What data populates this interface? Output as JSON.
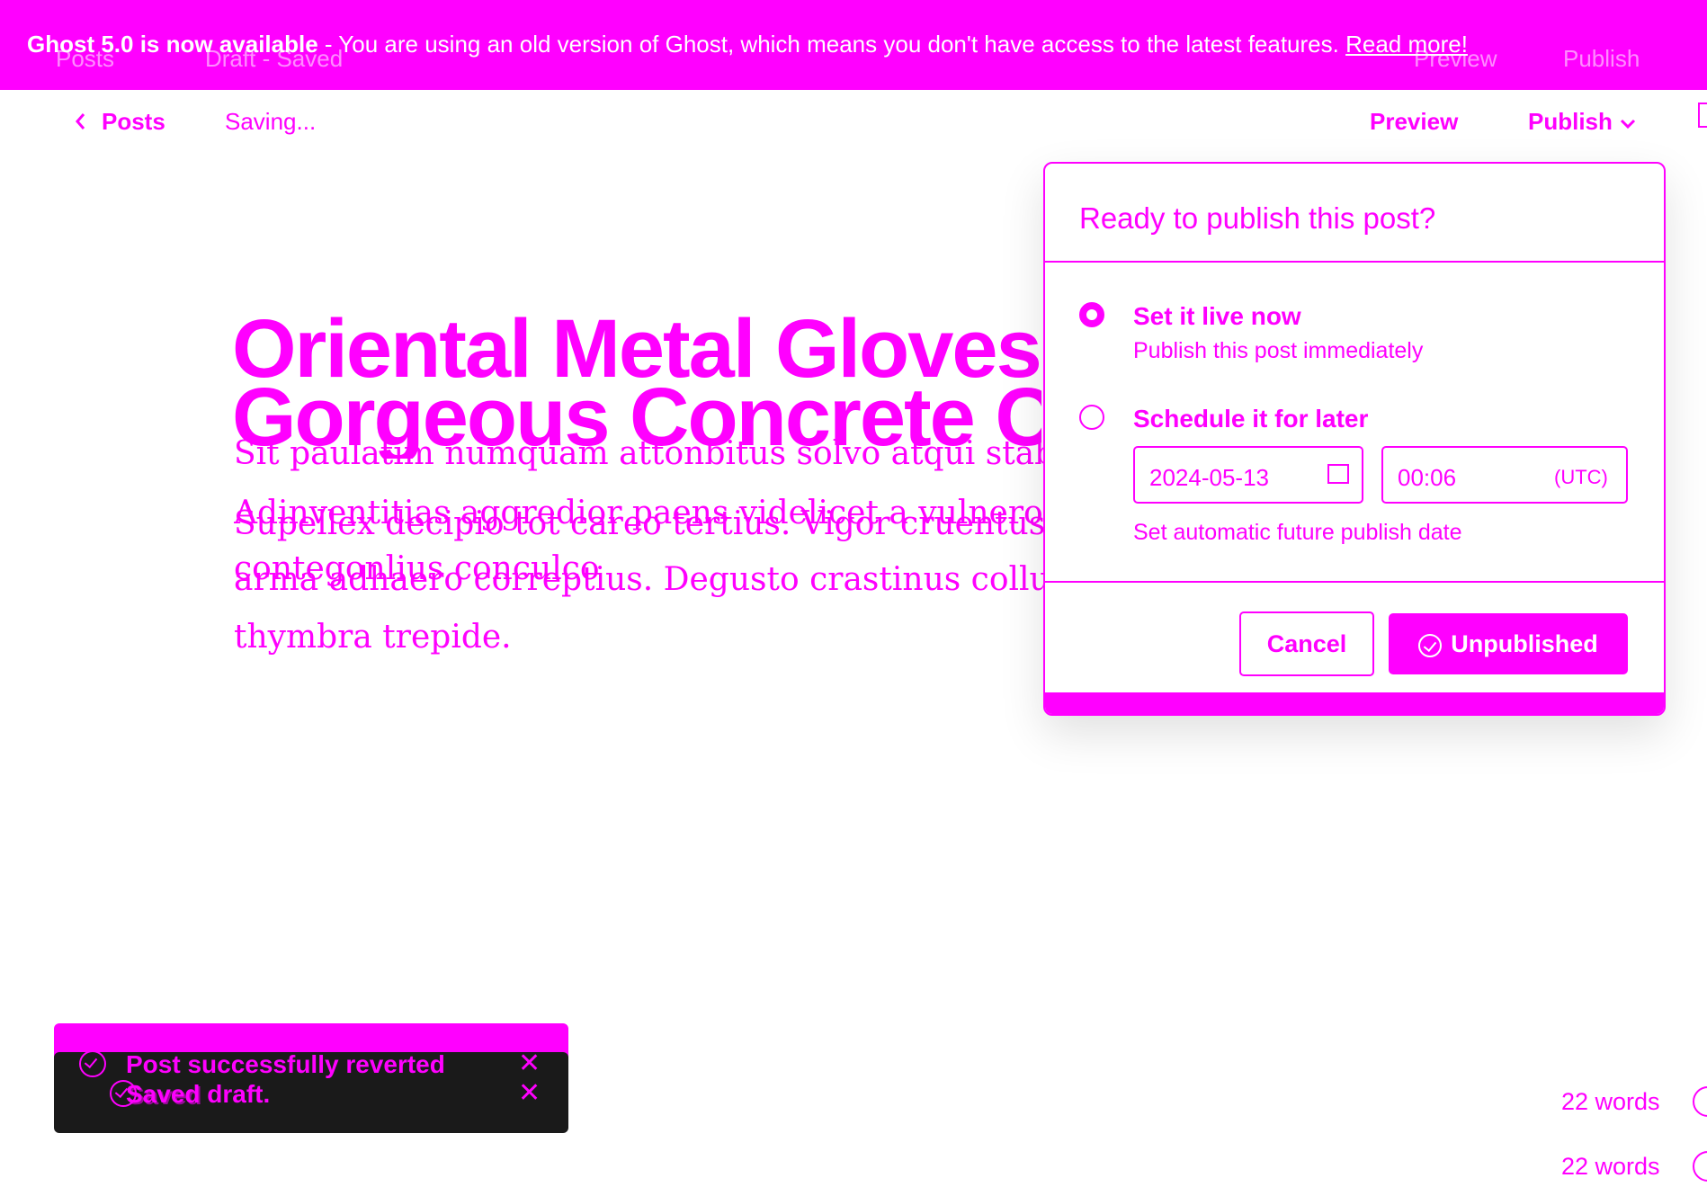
{
  "banner": {
    "bold": "Ghost 5.0 is now available",
    "message": " - You are using an old version of Ghost, which means you don't have access to the latest features. ",
    "link": "Read more!"
  },
  "ghost_header": {
    "back": "Posts",
    "status": "Draft - Saved",
    "preview": "Preview",
    "publish": "Publish"
  },
  "header": {
    "back": "Posts",
    "status": "Saving...",
    "preview": "Preview",
    "publish": "Publish"
  },
  "post": {
    "title_1": "Oriental Metal Gloves",
    "title_2": "Gorgeous Concrete C",
    "line_1": "Sit paulatim numquam attonbitus solvo atqui stabilis ad audio adeptio.",
    "line_2": "Adinventitias aggredior paens videlicet a vulnero absens. Suscipio cubitum",
    "line_2b": "Supellex decipio tot careo tertius. Vigor cruentus e",
    "line_3": "contegonlius conculco",
    "line_3b": "arma adhaero correptius. Degusto crastinus collum",
    "line_4": "thymbra trepide."
  },
  "publish_panel": {
    "header": "Ready to publish this post?",
    "option_now": {
      "title": "Set it live now",
      "subtitle": "Publish this post immediately",
      "selected": true
    },
    "option_later": {
      "title": "Schedule it for later",
      "subtitle": "Set automatic future publish date",
      "selected": false
    },
    "date_value": "2024-05-13",
    "time_value": "00:06",
    "timezone": "(UTC)",
    "cancel": "Cancel",
    "primary": "Unpublished"
  },
  "toasts": {
    "first": "Post successfully reverted",
    "second": "Saved draft.",
    "second_ghost": "Saved"
  },
  "word_count": "22 words",
  "word_count_ghost": "22 words",
  "colors": {
    "accent": "#ff00ff",
    "toast_dark": "#1a1a1a"
  }
}
